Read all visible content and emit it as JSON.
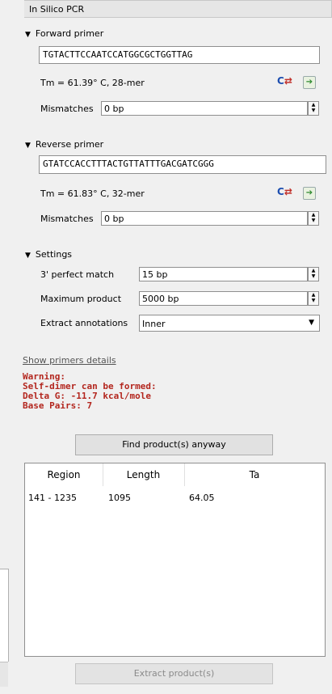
{
  "panel_title": "In Silico PCR",
  "forward": {
    "header": "Forward primer",
    "sequence": "TGTACTTCCAATCCATGGCGCTGGTTAG",
    "tm": "Tm = 61.39° C, 28-mer",
    "mismatches_label": "Mismatches",
    "mismatches_value": "0 bp"
  },
  "reverse": {
    "header": "Reverse primer",
    "sequence": "GTATCCACCTTTACTGTTATTTGACGATCGGG",
    "tm": "Tm = 61.83° C, 32-mer",
    "mismatches_label": "Mismatches",
    "mismatches_value": "0 bp"
  },
  "settings": {
    "header": "Settings",
    "perfect_match_label": "3' perfect match",
    "perfect_match_value": "15 bp",
    "max_product_label": "Maximum product",
    "max_product_value": "5000 bp",
    "extract_label": "Extract annotations",
    "extract_value": "Inner"
  },
  "show_primers_details": "Show primers details",
  "warning": {
    "line1": "Warning:",
    "line2": "Self-dimer can be formed:",
    "line3": "Delta G: -11.7 kcal/mole",
    "line4": "Base Pairs: 7"
  },
  "find_button": "Find product(s) anyway",
  "table": {
    "headers": [
      "Region",
      "Length",
      "Ta"
    ],
    "rows": [
      [
        "141 - 1235",
        "1095",
        "64.05"
      ]
    ]
  },
  "extract_button": "Extract product(s)",
  "icons": {
    "collapse": "triangle-down-icon",
    "complement": "complement-icon",
    "go": "go-to-sequence-icon",
    "spinner": "spinner-arrows-icon",
    "dropdown": "chevron-down-icon"
  },
  "colors": {
    "warning": "#b3261e",
    "link": "#555555"
  }
}
